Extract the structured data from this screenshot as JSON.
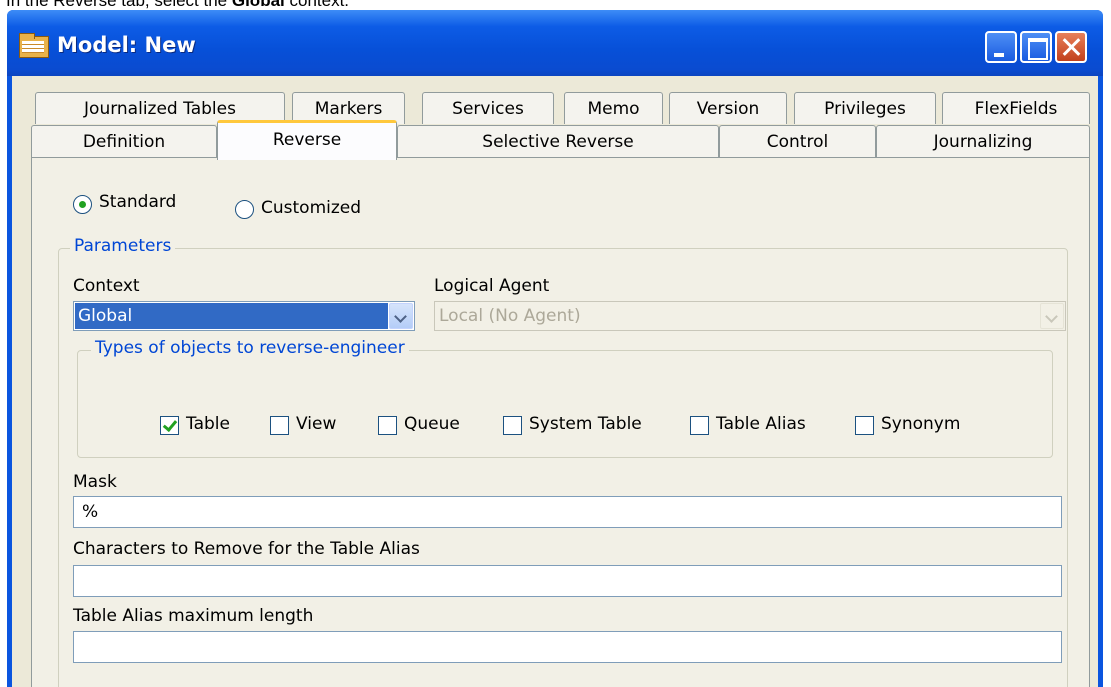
{
  "instruction": {
    "prefix": "In the Reverse tab, select the ",
    "bold": "Global",
    "suffix": " context."
  },
  "window": {
    "title": "Model: New"
  },
  "tabs": {
    "row1": [
      "Journalized Tables",
      "Markers",
      "Services",
      "Memo",
      "Version",
      "Privileges",
      "FlexFields"
    ],
    "row2": [
      "Definition",
      "Reverse",
      "Selective Reverse",
      "Control",
      "Journalizing"
    ],
    "active": "Reverse"
  },
  "reverse_mode": {
    "standard": "Standard",
    "customized": "Customized",
    "selected": "Standard"
  },
  "parameters": {
    "title": "Parameters",
    "context_label": "Context",
    "context_value": "Global",
    "agent_label": "Logical Agent",
    "agent_value": "Local (No Agent)",
    "types_title": "Types of objects to reverse-engineer",
    "types": [
      {
        "label": "Table",
        "checked": true
      },
      {
        "label": "View",
        "checked": false
      },
      {
        "label": "Queue",
        "checked": false
      },
      {
        "label": "System Table",
        "checked": false
      },
      {
        "label": "Table Alias",
        "checked": false
      },
      {
        "label": "Synonym",
        "checked": false
      }
    ],
    "mask_label": "Mask",
    "mask_value": "%",
    "remove_chars_label": "Characters to Remove for the Table Alias",
    "remove_chars_value": "",
    "alias_len_label": "Table Alias maximum length",
    "alias_len_value": ""
  }
}
